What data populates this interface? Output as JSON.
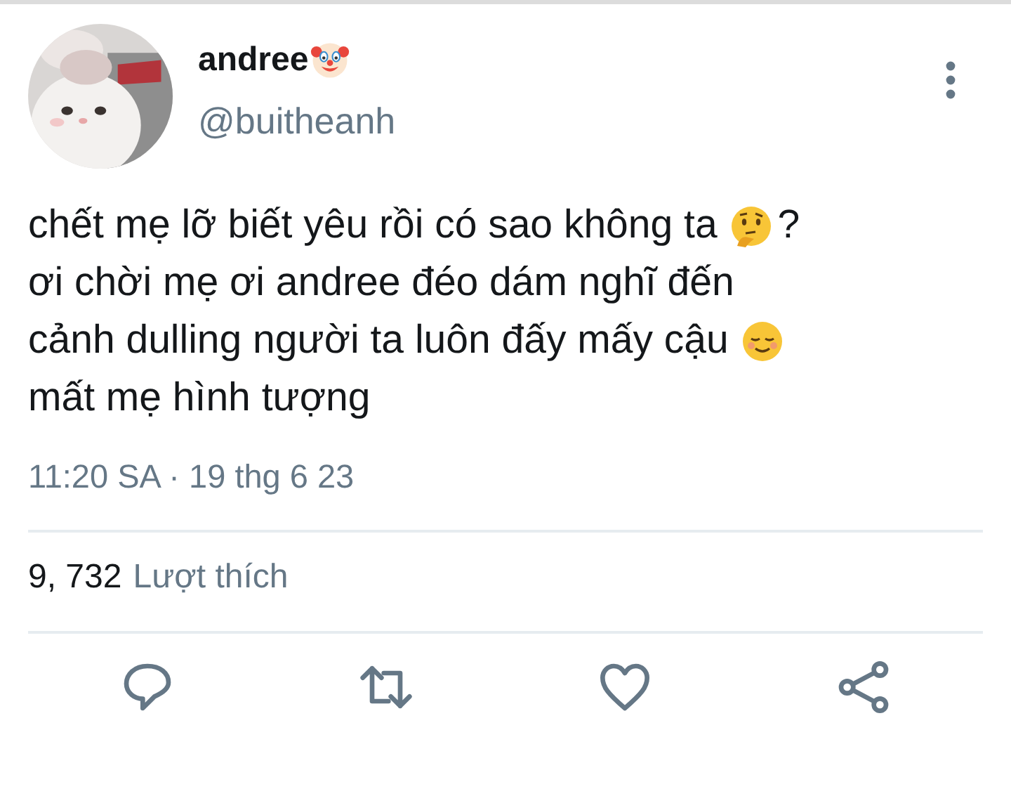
{
  "tweet": {
    "author": {
      "name": "andree",
      "handle": "@buitheanh"
    },
    "body": [
      [
        {
          "kind": "text",
          "text": "chết mẹ lỡ biết yêu rồi có sao không ta"
        },
        {
          "kind": "thinking"
        },
        {
          "kind": "text",
          "text": "?"
        }
      ],
      [
        {
          "kind": "text",
          "text": "ơi chời mẹ ơi andree đéo dám nghĩ đến"
        }
      ],
      [
        {
          "kind": "text",
          "text": "cảnh dulling người ta luôn đấy mấy cậu"
        },
        {
          "kind": "relieved"
        }
      ],
      [
        {
          "kind": "text",
          "text": "mất mẹ hình tượng"
        }
      ]
    ],
    "timestamp": "11:20 SA · 19 thg 6 23",
    "likes": {
      "count": "9, 732",
      "label": "Lượt thích"
    },
    "actions": [
      {
        "kind": "reply"
      },
      {
        "kind": "retweet"
      },
      {
        "kind": "like"
      },
      {
        "kind": "share"
      }
    ]
  }
}
